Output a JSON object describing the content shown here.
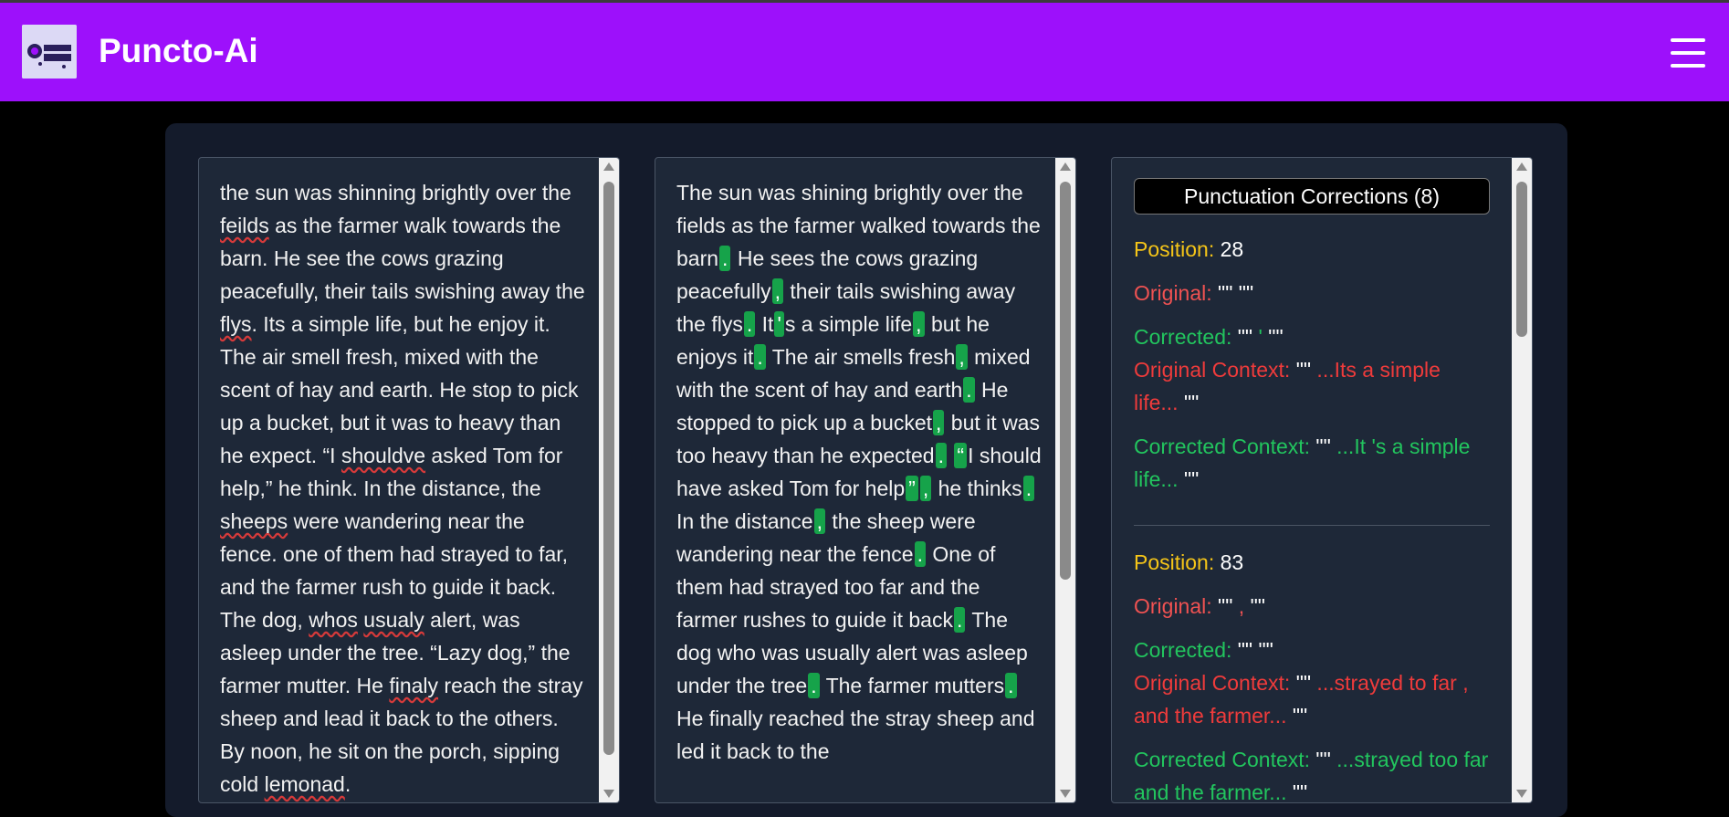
{
  "app": {
    "title": "Puncto-Ai",
    "logo_text": "PUNCTO AI"
  },
  "original_text": [
    {
      "t": "the sun was shinning brightly over the "
    },
    {
      "t": "feilds",
      "spell": true
    },
    {
      "t": " as the farmer walk towards the barn. He see the cows grazing peacefully, their tails swishing away the "
    },
    {
      "t": "flys",
      "spell": true
    },
    {
      "t": ". Its a simple life, but he enjoy it. The air smell fresh, mixed with the scent of hay and earth. He stop to pick up a bucket, but it was to heavy than he expect. “I "
    },
    {
      "t": "shouldve",
      "spell": true
    },
    {
      "t": " asked Tom for help,” he think. In the distance, the "
    },
    {
      "t": "sheeps",
      "spell": true
    },
    {
      "t": " were wandering near the fence. one of them had strayed to far, and the farmer rush to guide it back. The dog, "
    },
    {
      "t": "whos",
      "spell": true
    },
    {
      "t": " "
    },
    {
      "t": "usualy",
      "spell": true
    },
    {
      "t": " alert, was asleep under the tree. “Lazy dog,” the farmer mutter. He "
    },
    {
      "t": "finaly",
      "spell": true
    },
    {
      "t": " reach the stray sheep and lead it back to the others. By noon, he sit on the porch, sipping cold "
    },
    {
      "t": "lemonad",
      "spell": true
    },
    {
      "t": "."
    }
  ],
  "corrected_text": [
    {
      "t": "The sun was shining brightly over the fields as the farmer walked towards the barn"
    },
    {
      "t": ".",
      "mark": true
    },
    {
      "t": " He sees the cows grazing peacefully"
    },
    {
      "t": ",",
      "mark": true
    },
    {
      "t": " their tails swishing away the flys"
    },
    {
      "t": ".",
      "mark": true
    },
    {
      "t": " It"
    },
    {
      "t": "'",
      "mark": true
    },
    {
      "t": "s a simple life"
    },
    {
      "t": ",",
      "mark": true
    },
    {
      "t": " but he enjoys it"
    },
    {
      "t": ".",
      "mark": true
    },
    {
      "t": " The air smells fresh"
    },
    {
      "t": ",",
      "mark": true
    },
    {
      "t": " mixed with the scent of hay and earth"
    },
    {
      "t": ".",
      "mark": true
    },
    {
      "t": " He stopped to pick up a bucket"
    },
    {
      "t": ",",
      "mark": true
    },
    {
      "t": " but it was too heavy than he expected"
    },
    {
      "t": ".",
      "mark": true
    },
    {
      "t": " "
    },
    {
      "t": "“",
      "mark": true
    },
    {
      "t": "I should have asked Tom for help"
    },
    {
      "t": "”",
      "mark": true
    },
    {
      "t": ",",
      "mark": true
    },
    {
      "t": " he thinks"
    },
    {
      "t": ".",
      "mark": true
    },
    {
      "t": " In the distance"
    },
    {
      "t": ",",
      "mark": true
    },
    {
      "t": " the sheep were wandering near the fence"
    },
    {
      "t": ".",
      "mark": true
    },
    {
      "t": " One of them had strayed too far and the farmer rushes to guide it back"
    },
    {
      "t": ".",
      "mark": true
    },
    {
      "t": " The dog who was usually alert was asleep under the tree"
    },
    {
      "t": ".",
      "mark": true
    },
    {
      "t": " The farmer mutters"
    },
    {
      "t": ".",
      "mark": true
    },
    {
      "t": " He finally reached the stray sheep and led it back to the"
    }
  ],
  "corrections": {
    "title": "Punctuation Corrections (8)",
    "labels": {
      "position": "Position:",
      "original": "Original:",
      "corrected": "Corrected:",
      "original_context": "Original Context:",
      "corrected_context": "Corrected Context:"
    },
    "entries": [
      {
        "position": "28",
        "original_pre": "\"\"",
        "original_val": " ",
        "original_post": "\"\"",
        "corrected_pre": "\"\"",
        "corrected_val": " ' ",
        "corrected_post": "\"\"",
        "original_context_pre": "\"\"",
        "original_context": " ...Its a simple life... ",
        "original_context_post": "\"\"",
        "corrected_context_pre": "\"\"",
        "corrected_context": " ...It 's a simple life... ",
        "corrected_context_post": "\"\""
      },
      {
        "position": "83",
        "original_pre": "\"\"",
        "original_val": " , ",
        "original_post": "\"\"",
        "corrected_pre": "\"\"",
        "corrected_val": " ",
        "corrected_post": "\"\"",
        "original_context_pre": "\"\"",
        "original_context": " ...strayed to far , and the farmer... ",
        "original_context_post": "\"\"",
        "corrected_context_pre": "\"\"",
        "corrected_context": " ...strayed too far and the farmer... ",
        "corrected_context_post": "\"\""
      }
    ]
  },
  "colors": {
    "header": "#9d10fb",
    "mark": "#16a34a",
    "position_label": "#f5c518",
    "original": "#f05252",
    "corrected": "#22c55e"
  },
  "icons": {
    "menu": "hamburger-menu-icon",
    "scroll_up": "scroll-up-arrow-icon",
    "scroll_down": "scroll-down-arrow-icon"
  }
}
